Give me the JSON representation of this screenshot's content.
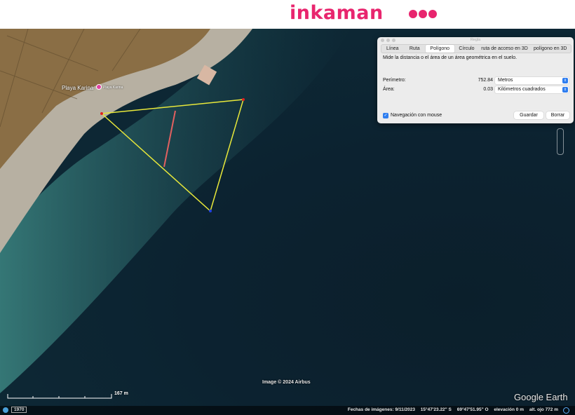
{
  "banner": {
    "logo_text": "inkaman",
    "brand_color": "#e8256e"
  },
  "map": {
    "place_label": "Playa Karina",
    "place_label_small": "Playa Karina",
    "attribution": "Image © 2024 Airbus",
    "brand": "Google Earth",
    "scale_label": "167 m",
    "polygon_color": "#e8e83a",
    "path_color": "#e06060",
    "status": {
      "year": "1970",
      "imagery_date": "Fechas de imágenes: 9/11/2023",
      "lat": "15°47'23.22\" S",
      "lon": "69°47'51.95\" O",
      "elevation": "elevación   0 m",
      "eye_alt": "alt. ojo   772 m"
    }
  },
  "dialog": {
    "title": "Regla",
    "tabs": [
      "Línea",
      "Ruta",
      "Polígono",
      "Círculo",
      "ruta de acceso en 3D",
      "polígono en 3D"
    ],
    "active_tab": "Polígono",
    "description": "Mide la distancia o el área de un área geométrica en el suelo.",
    "perimeter_label": "Perímetro:",
    "perimeter_value": "752.84",
    "perimeter_unit": "Metros",
    "area_label": "Área:",
    "area_value": "0.03",
    "area_unit": "Kilómetros cuadrados",
    "mouse_nav_label": "Navegación con mouse",
    "mouse_nav_checked": true,
    "save_label": "Guardar",
    "clear_label": "Borrar"
  }
}
